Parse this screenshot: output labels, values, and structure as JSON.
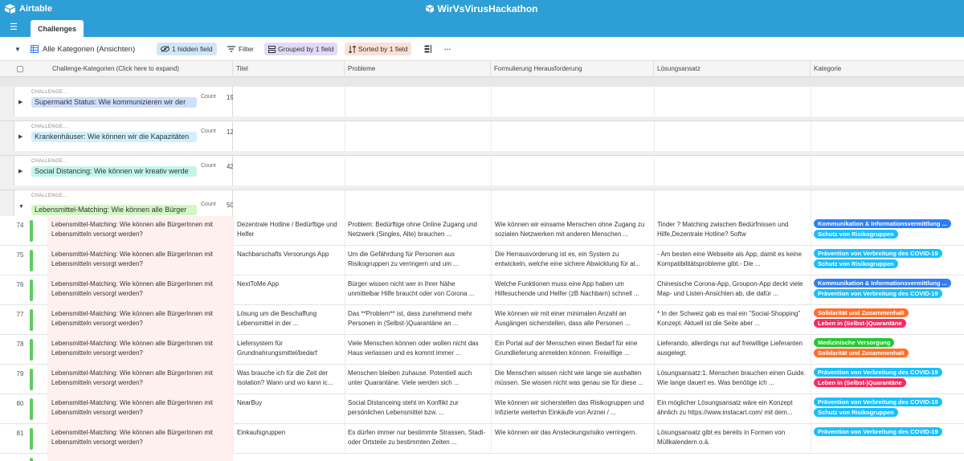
{
  "app": {
    "logo": "Airtable",
    "base_title": "WirVsVirusHackathon",
    "table_tab": "Challenges"
  },
  "viewbar": {
    "view_name": "Alle Kategorien (Ansichten)",
    "hidden": "1 hidden field",
    "filter": "Filter",
    "grouped": "Grouped by 1 field",
    "sorted": "Sorted by 1 field",
    "more": "···"
  },
  "columns": [
    "Challenge-Kategorien (Click here to expand)",
    "Titel",
    "Probleme",
    "Formulierung Herausforderung",
    "Lösungsansatz",
    "Kategorie"
  ],
  "groups": [
    {
      "label": "CHALLENGE...",
      "title": "Supermarkt Status: Wie kommunizieren wir der",
      "count_label": "Count",
      "count": "19",
      "color": "#cfdfff",
      "expanded": false
    },
    {
      "label": "CHALLENGE...",
      "title": "Krankenhäuser: Wie können wir die Kapazitäten",
      "count_label": "Count",
      "count": "12",
      "color": "#d0f0fd",
      "expanded": false
    },
    {
      "label": "CHALLENGE...",
      "title": "Social Distancing: Wie können wir kreativ werde",
      "count_label": "Count",
      "count": "42",
      "color": "#c2f5e9",
      "expanded": false
    },
    {
      "label": "CHALLENGE...",
      "title": "Lebensmittel-Matching: Wie können alle Bürger",
      "count_label": "Count",
      "count": "50",
      "color": "#d1f7c4",
      "expanded": true
    }
  ],
  "rows": [
    {
      "num": "74",
      "kategorie": "Lebensmittel-Matching: Wie können alle BürgerInnen mit Lebensmitteln versorgt werden?",
      "titel": "Dezentrale Hotline / Bedürftige und Helfer",
      "probleme": "Problem: Bedürftige ohne Online Zugang und Netzwerk (Singles, Alte) brauchen ...",
      "formulierung": "Wie können wir einsame Menschen ohne Zugang zu sozialen Netzwerken mit anderen Menschen ...",
      "loesung": "Tinder ? Matching zwischen Bedürfnissen und Hilfe,Dezentrale Hotline? Softw",
      "chips": [
        {
          "text": "Kommunikation & Informationsvermittlung ...",
          "color": "#2d7ff9"
        },
        {
          "text": "Schutz von Risikogruppen",
          "color": "#18bfff"
        }
      ]
    },
    {
      "num": "75",
      "kategorie": "Lebensmittel-Matching: Wie können alle BürgerInnen mit Lebensmitteln versorgt werden?",
      "titel": "Nachbarschafts Versorungs App",
      "probleme": "Um die Gefährdung für Personen aus Risikogruppen zu verringern und um ...",
      "formulierung": "Die Herrausvorderung ist es, ein System zu entwickeln, welche eine sichere Abwicklung für al...",
      "loesung": "- Am besten eine Webseite als App, damit es keine Kompatibilitätsprobleme gibt.- Die ...",
      "chips": [
        {
          "text": "Prävention von Verbreitung des COVID-19",
          "color": "#18bfff"
        },
        {
          "text": "Schutz von Risikogruppen",
          "color": "#18bfff"
        }
      ]
    },
    {
      "num": "76",
      "kategorie": "Lebensmittel-Matching: Wie können alle BürgerInnen mit Lebensmitteln versorgt werden?",
      "titel": "NextToMe App",
      "probleme": "Bürger wissen nicht wer in Ihrer Nähe unmittelbar Hilfe braucht oder von Corona ...",
      "formulierung": "Welche Funktionen muss eine App haben um Hilfesuchende und Helfer (zB Nachbarn) schnell ...",
      "loesung": "Chinesische Corona-App, Groupon-App deckt viele Map- und Listen-Ansichten ab, die dafür ...",
      "chips": [
        {
          "text": "Kommunikation & Informationsvermittlung ...",
          "color": "#2d7ff9"
        },
        {
          "text": "Prävention von Verbreitung des COVID-19",
          "color": "#18bfff"
        }
      ]
    },
    {
      "num": "77",
      "kategorie": "Lebensmittel-Matching: Wie können alle BürgerInnen mit Lebensmitteln versorgt werden?",
      "titel": "Lösung um die Beschaffung Lebensmittel in der ...",
      "probleme": "Das **Problem** ist, dass zunehmend mehr Personen in (Selbst-)Quarantäne an ...",
      "formulierung": "Wie können wir mit einer minimalen Anzahl an Ausgängen sicherstellen, dass alle Personen ...",
      "loesung": "* In der Schweiz gab es mal ein \"Social-Shopping\" Konzept. Aktuell ist die Seite aber ...",
      "chips": [
        {
          "text": "Solidarität und Zusammenhalt",
          "color": "#ff6f2c"
        },
        {
          "text": "Leben in (Selbst-)Quarantäne",
          "color": "#f82b60"
        }
      ]
    },
    {
      "num": "78",
      "kategorie": "Lebensmittel-Matching: Wie können alle BürgerInnen mit Lebensmitteln versorgt werden?",
      "titel": "Liefersystem für Grundnahrungsmittel/bedarf",
      "probleme": "Viele Menschen können oder wollen nicht das Haus verlassen und es kommt immer ...",
      "formulierung": "Ein Portal auf der Menschen einen Bedarf für eine Grundlieferung anmelden können. Freiwillige ...",
      "loesung": "Lieferando, allerdings nur auf freiwillige Lieferanten ausgelegt.",
      "chips": [
        {
          "text": "Medizinische Versorgung",
          "color": "#20c933"
        },
        {
          "text": "Solidarität und Zusammenhalt",
          "color": "#ff6f2c"
        }
      ]
    },
    {
      "num": "79",
      "kategorie": "Lebensmittel-Matching: Wie können alle BürgerInnen mit Lebensmitteln versorgt werden?",
      "titel": "Was brauche ich für die Zeit der Isolation? Wann und wo kann ic...",
      "probleme": "Menschen bleiben zuhause. Potentiell auch unter Quarantäne. Viele werden sich ...",
      "formulierung": "Die Menschen wissen nicht wie lange sie aushalten müssen. Sie wissen nicht was genau sie für diese ...",
      "loesung": "Lösungsansatz:1. Menschen brauchen einen Guide. Wie lange dauert es. Was benötige ich ...",
      "chips": [
        {
          "text": "Prävention von Verbreitung des COVID-19",
          "color": "#18bfff"
        },
        {
          "text": "Leben in (Selbst-)Quarantäne",
          "color": "#f82b60"
        }
      ]
    },
    {
      "num": "80",
      "kategorie": "Lebensmittel-Matching: Wie können alle BürgerInnen mit Lebensmitteln versorgt werden?",
      "titel": "NearBuy",
      "probleme": "Social Distanceing steht im Konflikt zur persönlichen Lebensmittel bzw. ...",
      "formulierung": "Wie können wir sicherstellen das Risikogruppen und Infizierte weiterhin Einkäufe von Arznei / ...",
      "loesung": "Ein möglicher Lösungsansatz wäre ein Konzept ähnlich zu https://www.instacart.com/ mit dem...",
      "chips": [
        {
          "text": "Prävention von Verbreitung des COVID-19",
          "color": "#18bfff"
        },
        {
          "text": "Schutz von Risikogruppen",
          "color": "#18bfff"
        }
      ]
    },
    {
      "num": "81",
      "kategorie": "Lebensmittel-Matching: Wie können alle BürgerInnen mit Lebensmitteln versorgt werden?",
      "titel": "Einkaufsgruppen",
      "probleme": "Es dürfen immer nur bestimmte Strassen, Stadt- oder Ortsteile zu bestimmten Zeiten ...",
      "formulierung": "Wie können wir das Ansteckungsrisiko verringern.",
      "loesung": "Lösungsansatz gibt es bereits in Formen von Müllkalendern o.ä.",
      "chips": [
        {
          "text": "Prävention von Verbreitung des COVID-19",
          "color": "#18bfff"
        }
      ]
    }
  ]
}
